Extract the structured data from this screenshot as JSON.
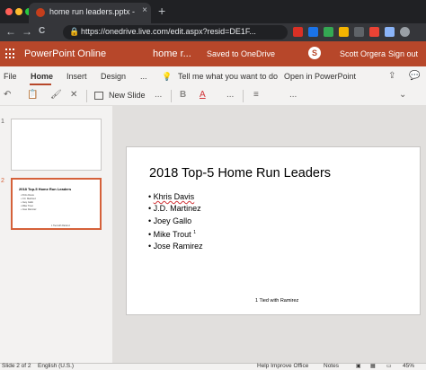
{
  "browser": {
    "tab_title": "home run leaders.pptx - Micro",
    "tab_close": "×",
    "new_tab": "+",
    "url": "https://onedrive.live.com/edit.aspx?resid=DE1F...",
    "lock": "🔒"
  },
  "nav": {
    "back": "←",
    "forward": "→",
    "reload": "C"
  },
  "extensions": {
    "colors": [
      "#d93025",
      "#1a73e8",
      "#34a853",
      "#f4b400",
      "#5f6368",
      "#ea4335",
      "#8ab4f8",
      "#9aa0a6"
    ]
  },
  "app": {
    "name": "PowerPoint Online",
    "doc_name": "home r...",
    "saved": "Saved to OneDrive",
    "skype": "S",
    "user": "Scott Orgera",
    "sign_out": "Sign out",
    "accent": "#b7472a"
  },
  "ribbon": {
    "tabs": [
      "File",
      "Home",
      "Insert",
      "Design",
      "..."
    ],
    "tell_me": "Tell me what you want to do",
    "open_in": "Open in PowerPoint",
    "bulb": "💡"
  },
  "toolbar": {
    "undo": "↶",
    "paste": "📋",
    "format_painter": "🖌",
    "delete": "✕",
    "new_slide": "New Slide",
    "more1": "...",
    "bold": "B",
    "font_color": "A",
    "more2": "...",
    "bullets": "≡",
    "more3": "...",
    "comment": "💬"
  },
  "thumbnails": [
    {
      "num": "1",
      "title": "",
      "lines": [],
      "foot": ""
    },
    {
      "num": "2",
      "title": "2018 Top-5 Home Run Leaders",
      "lines": [
        "• Khris Davis",
        "• J.D. Martinez",
        "• Joey Gallo",
        "• Mike Trout",
        "• Jose Ramirez"
      ],
      "foot": "1 Tied with Ramirez"
    }
  ],
  "slide": {
    "title": "2018 Top-5 Home Run Leaders",
    "items": [
      "Khris Davis",
      "J.D. Martinez",
      "Joey Gallo",
      "Mike Trout",
      "Jose Ramirez"
    ],
    "superscript": "1",
    "footnote": "1 Tied with Ramirez"
  },
  "status": {
    "slide_info": "Slide 2 of 2",
    "language": "English (U.S.)",
    "help": "Help Improve Office",
    "notes": "Notes",
    "zoom": "45%"
  }
}
